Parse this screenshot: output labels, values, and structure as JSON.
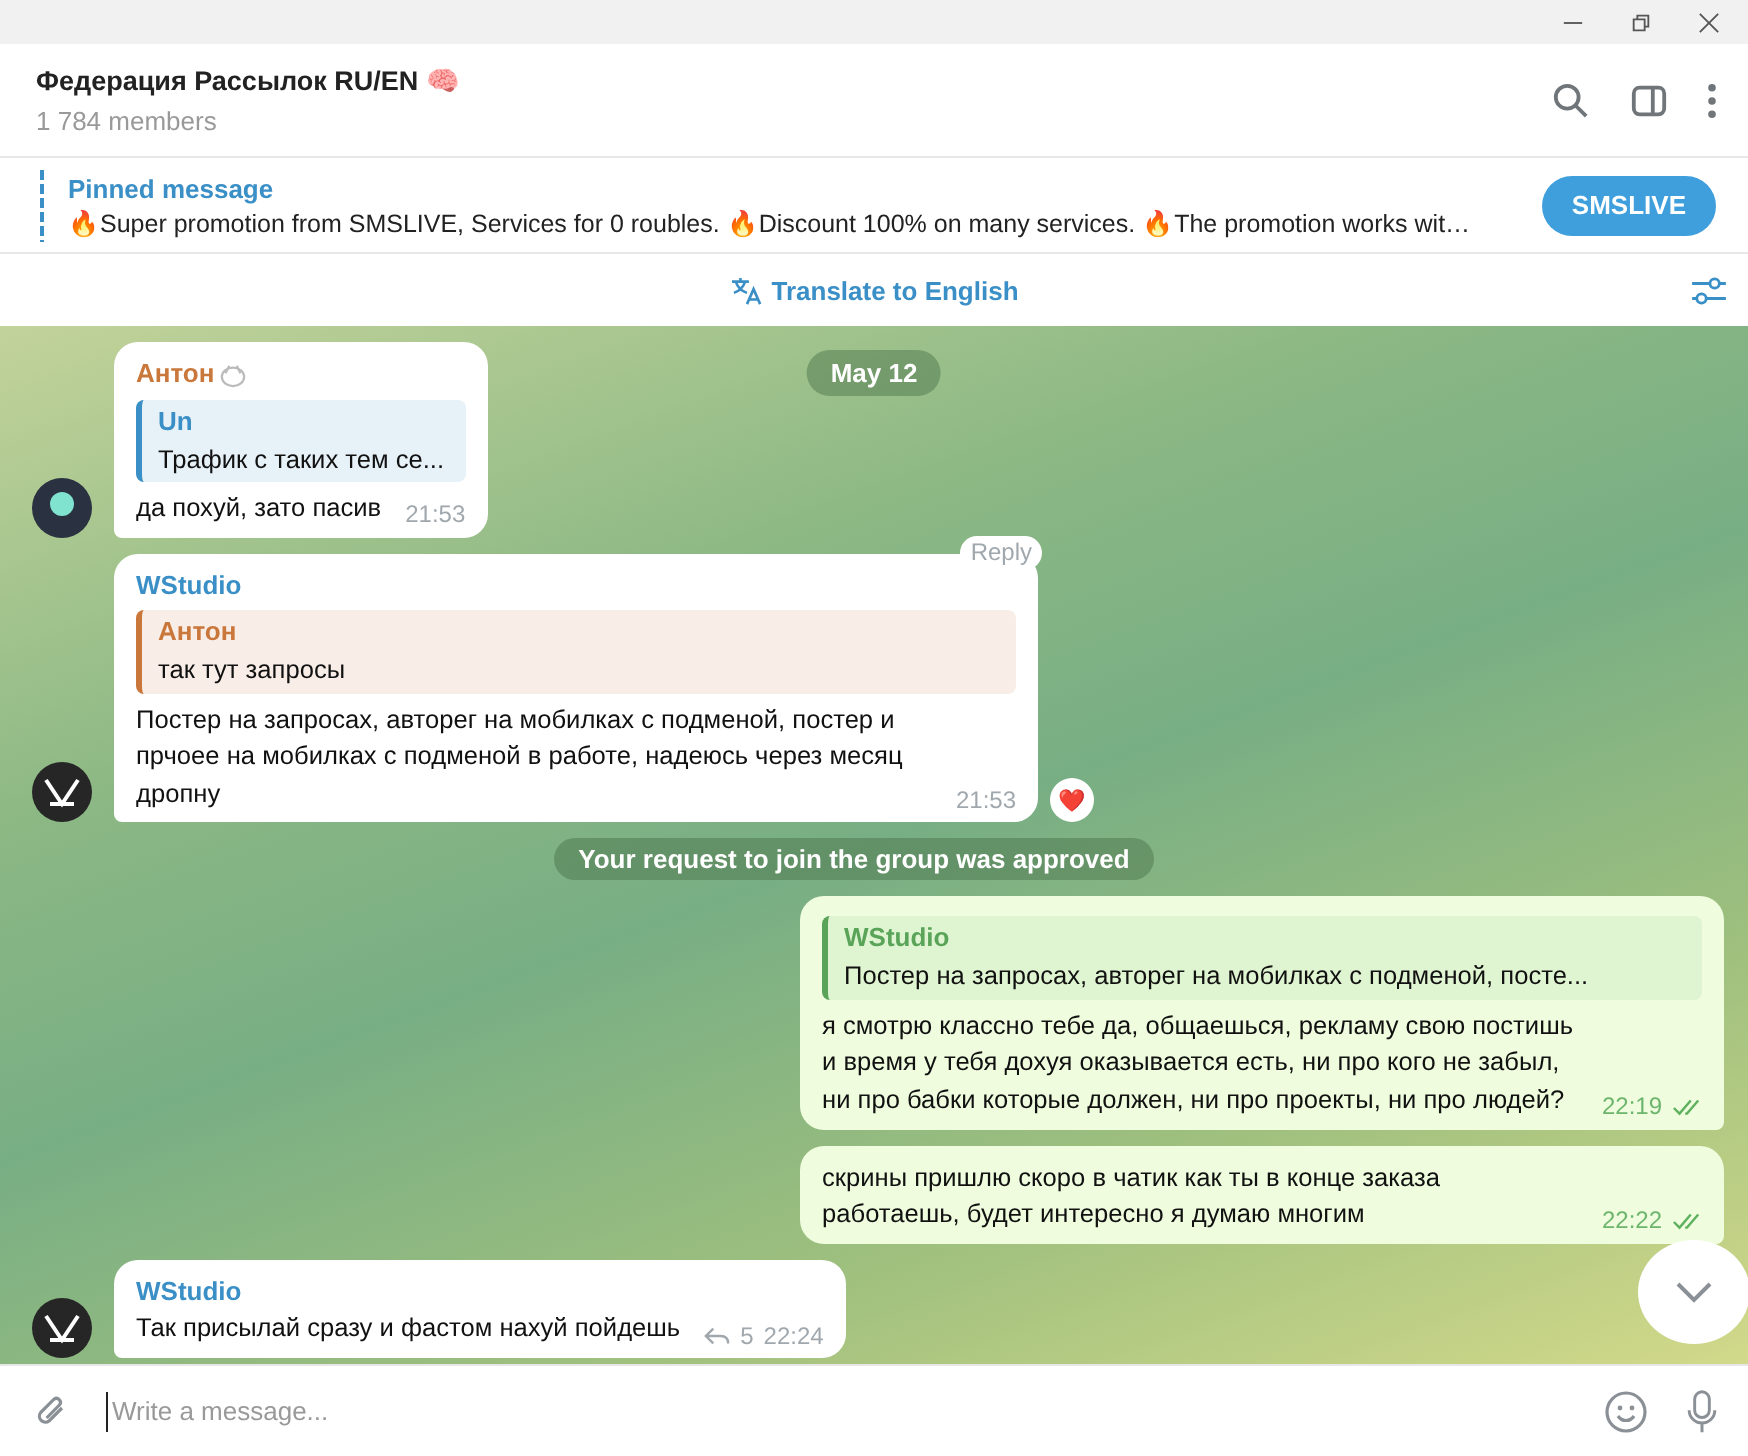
{
  "header": {
    "title": "Федерация Рассылок RU/EN 🧠",
    "subtitle": "1 784 members"
  },
  "pinned": {
    "label": "Pinned message",
    "text": "🔥Super promotion from SMSLIVE, Services for 0 roubles. 🔥Discount 100% on many services. 🔥The promotion works wit…",
    "button": "SMSLIVE"
  },
  "translate_bar": {
    "label": "Translate to English"
  },
  "date_badge": "May 12",
  "messages": [
    {
      "kind": "incoming",
      "author": {
        "name": "Антон",
        "color": "#c9773b"
      },
      "avatar": {
        "kind": "glow"
      },
      "quote": {
        "author": "Un",
        "color": "#3a8fc7",
        "text": "Трафик с таких тем се..."
      },
      "text": "да похуй, зато пасив",
      "time": "21:53",
      "author_badge": true
    },
    {
      "kind": "incoming",
      "author": {
        "name": "WStudio",
        "color": "#3a8fc7"
      },
      "avatar": {
        "kind": "logo"
      },
      "quote": {
        "author": "Антон",
        "color": "#c9773b",
        "text": "так тут запросы"
      },
      "text": "Постер на запросах, авторег на мобилках с подменой, постер и прчоее на мобилках с подменой в работе, надеюсь через месяц дропну",
      "time": "21:53",
      "reply_hint": "Reply",
      "reaction": "❤️"
    },
    {
      "kind": "service",
      "text": "Your request to join the group was approved"
    },
    {
      "kind": "outgoing",
      "quote": {
        "author": "WStudio",
        "color": "#5aa45a",
        "text": "Постер на запросах, авторег на мобилках с подменой, посте..."
      },
      "text": "я смотрю классно тебе да, общаешься, рекламу свою постишь и время у тебя дохуя оказывается есть, ни про кого не забыл, ни про бабки которые должен, ни про проекты, ни про людей?",
      "time": "22:19",
      "read": true
    },
    {
      "kind": "outgoing",
      "text": "скрины пришлю скоро в чатик как ты в конце заказа работаешь, будет интересно я думаю многим",
      "time": "22:22",
      "read": true
    },
    {
      "kind": "incoming",
      "author": {
        "name": "WStudio",
        "color": "#3a8fc7"
      },
      "avatar": {
        "kind": "logo"
      },
      "text": "Так присылай сразу и фастом нахуй пойдешь",
      "time": "22:24",
      "replies": "5"
    }
  ],
  "composer": {
    "placeholder": "Write a message..."
  }
}
